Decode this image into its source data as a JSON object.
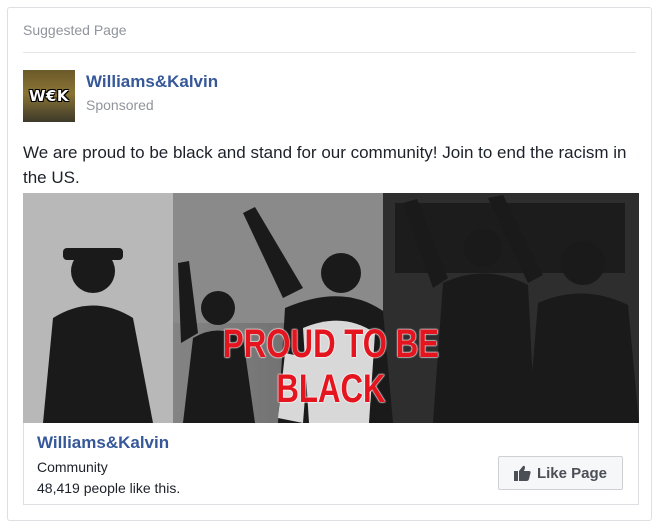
{
  "card": {
    "header_label": "Suggested Page"
  },
  "post": {
    "page_name": "Williams&Kalvin",
    "sponsored_label": "Sponsored",
    "avatar_text": "W€K",
    "message": "We are proud to be black and stand for our community! Join to end the racism in the US."
  },
  "image": {
    "headline_line_1": "PROUD TO BE",
    "headline_line_2": "BLACK",
    "headline_color": "#e4151f"
  },
  "footer": {
    "page_name": "Williams&Kalvin",
    "category": "Community",
    "likes_text": "48,419 people like this.",
    "like_button_label": "Like Page",
    "like_button_icon": "thumbs-up-icon"
  },
  "colors": {
    "link_blue": "#365899",
    "secondary_text": "#90949c",
    "body_text": "#1d2129",
    "border": "#dddfe2"
  }
}
